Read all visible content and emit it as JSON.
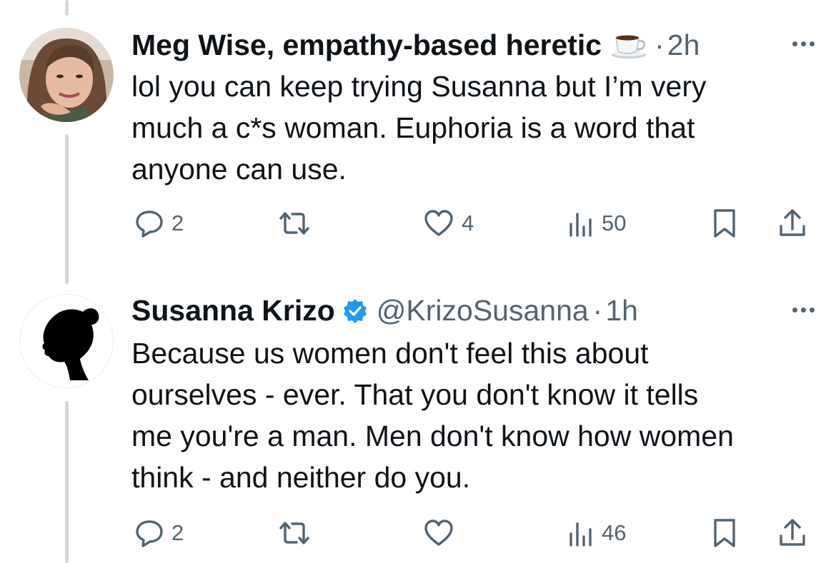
{
  "tweets": [
    {
      "author_name": "Meg Wise, empathy-based heretic",
      "name_emoji": "☕",
      "dot": "·",
      "time": "2h",
      "text_lines": [
        "lol you can keep trying Susanna but I’m very",
        "much a c*s woman. Euphoria is a word that",
        "anyone can use."
      ],
      "counts": {
        "replies": "2",
        "likes": "4",
        "views": "50"
      }
    },
    {
      "author_name": "Susanna Krizo",
      "handle": "@KrizoSusanna",
      "dot": "·",
      "time": "1h",
      "verified": true,
      "text_lines": [
        "Because us women don't feel this about",
        "ourselves - ever. That you don't know it tells",
        "me you're a man. Men don't know how women",
        "think - and neither do you."
      ],
      "counts": {
        "replies": "2",
        "views": "46"
      }
    }
  ],
  "colors": {
    "text": "#0f1419",
    "muted": "#536471",
    "thread_line": "#cfd9de",
    "verified_badge": "#1d9bf0"
  },
  "icons": [
    "reply-icon",
    "retweet-icon",
    "like-icon",
    "views-icon",
    "bookmark-icon",
    "share-icon",
    "more-icon",
    "verified-badge-icon",
    "coffee-emoji"
  ]
}
